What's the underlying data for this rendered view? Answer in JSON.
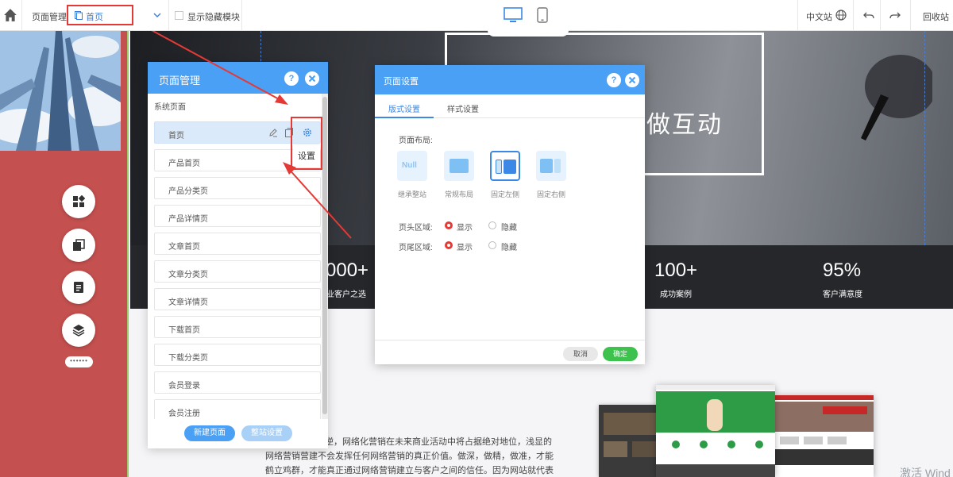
{
  "toolbar": {
    "page_manage_label": "页面管理:",
    "current_page": "首页",
    "show_hidden_label": "显示隐藏模块",
    "language": "中文站",
    "recycle": "回收站"
  },
  "hero": {
    "title": "做互动"
  },
  "stats": [
    {
      "num": "000+",
      "label": "业客户之选"
    },
    {
      "num": "100+",
      "label": "成功案例"
    },
    {
      "num": "95%",
      "label": "客户满意度"
    }
  ],
  "body_text": "中逆，网络化营销在未来商业活动中将占据绝对地位，浅显的网络营销营建不会发挥任何网络营销的真正价值。做深，做精，做准，才能鹤立鸡群，才能真正通过网络营销建立与客户之间的信任。因为网站就代表了你的产品和服务，也代表了背后的企业文化和经营理念。",
  "watermark": "激活 Wind",
  "page_manager": {
    "title": "页面管理",
    "help": "?",
    "section": "系统页面",
    "items": [
      "首页",
      "产品首页",
      "产品分类页",
      "产品详情页",
      "文章首页",
      "文章分类页",
      "文章详情页",
      "下载首页",
      "下载分类页",
      "会员登录",
      "会员注册"
    ],
    "tooltip": "设置",
    "new_page": "新建页面",
    "site_settings": "整站设置"
  },
  "page_settings": {
    "title": "页面设置",
    "help": "?",
    "tabs": [
      "版式设置",
      "样式设置"
    ],
    "layout_label": "页面布局:",
    "layouts": [
      {
        "label": "继承整站",
        "text": "Null"
      },
      {
        "label": "常规布局"
      },
      {
        "label": "固定左侧"
      },
      {
        "label": "固定右侧"
      }
    ],
    "header_label": "页头区域:",
    "footer_label": "页尾区域:",
    "show": "显示",
    "hide": "隐藏",
    "cancel": "取消",
    "ok": "确定"
  },
  "colors": {
    "accent": "#4aa0f5",
    "highlight": "#e53935",
    "ok": "#3ec24e",
    "sidebar": "#c4504f"
  }
}
